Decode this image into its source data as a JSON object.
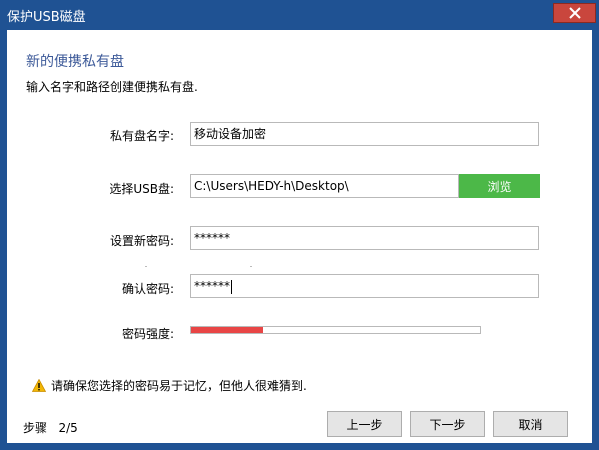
{
  "window": {
    "title": "保护USB磁盘"
  },
  "heading": "新的便携私有盘",
  "subheading": "输入名字和路径创建便携私有盘.",
  "fields": {
    "name": {
      "label": "私有盘名字:",
      "value": "移动设备加密"
    },
    "usb": {
      "label": "选择USB盘:",
      "value": "C:\\Users\\HEDY-h\\Desktop\\",
      "browse_label": "浏览"
    },
    "new_password": {
      "label": "设置新密码:",
      "value": "******"
    },
    "confirm_password": {
      "label": "确认密码:",
      "value": "******"
    },
    "strength": {
      "label": "密码强度:",
      "level": 0.25
    }
  },
  "warning": "请确保您选择的密码易于记忆，但他人很难猜到.",
  "steps": "步骤   2/5",
  "buttons": {
    "prev": "上一步",
    "next": "下一步",
    "cancel": "取消"
  },
  "colors": {
    "titlebar": "#1f5293",
    "browse": "#4cb848",
    "strength": "#e84545",
    "heading": "#3d5a99"
  }
}
